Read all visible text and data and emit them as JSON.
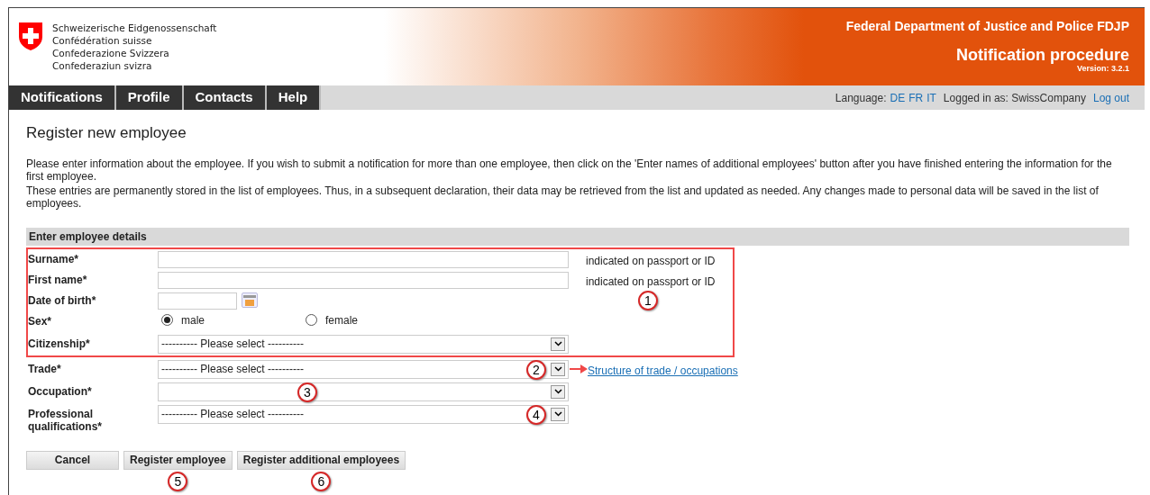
{
  "header": {
    "logo_lines": [
      "Schweizerische Eidgenossenschaft",
      "Confédération suisse",
      "Confederazione Svizzera",
      "Confederaziun svizra"
    ],
    "department": "Federal Department of Justice and Police FDJP",
    "app_title": "Notification procedure",
    "version": "Version: 3.2.1"
  },
  "nav": {
    "tabs": [
      {
        "label": "Notifications"
      },
      {
        "label": "Profile"
      },
      {
        "label": "Contacts"
      },
      {
        "label": "Help"
      }
    ],
    "language_label": "Language:",
    "languages": [
      "DE",
      "FR",
      "IT"
    ],
    "logged_in": "Logged in as: SwissCompany",
    "logout": "Log out"
  },
  "page_title": "Register new employee",
  "intro": [
    "Please enter information about the employee. If you wish to submit a notification for more than one employee, then click on the 'Enter names of additional employees' button after you have finished entering the information for the first employee.",
    "These entries are permanently stored in the list of employees. Thus, in a subsequent declaration, their data may be retrieved from the list and updated as needed. Any changes made to personal data will be saved in the list of employees."
  ],
  "section_title": "Enter employee details",
  "highlight_callout": "1",
  "fields": [
    {
      "kind": "text",
      "label": "Surname*",
      "hint": "indicated on passport or ID",
      "highlighted": true
    },
    {
      "kind": "text",
      "label": "First name*",
      "hint": "indicated on passport or ID",
      "highlighted": true
    },
    {
      "kind": "date",
      "label": "Date of birth*",
      "highlighted": true
    },
    {
      "kind": "radio",
      "label": "Sex*",
      "highlighted": true,
      "options": [
        {
          "label": "male",
          "selected": true
        },
        {
          "label": "female",
          "selected": false
        }
      ]
    },
    {
      "kind": "select",
      "label": "Citizenship*",
      "value": "---------- Please select ----------",
      "highlighted": true
    },
    {
      "kind": "select",
      "label": "Trade*",
      "value": "---------- Please select ----------",
      "highlighted": false,
      "callout": "2",
      "link": "Structure of trade / occupations"
    },
    {
      "kind": "select",
      "label": "Occupation*",
      "highlighted": false,
      "callout": "3"
    },
    {
      "kind": "select",
      "label": "Professional qualifications*",
      "value": "---------- Please select ----------",
      "highlighted": false,
      "callout": "4"
    }
  ],
  "buttons": [
    {
      "label": "Cancel"
    },
    {
      "label": "Register employee",
      "callout": "5"
    },
    {
      "label": "Register additional employees",
      "callout": "6"
    }
  ]
}
